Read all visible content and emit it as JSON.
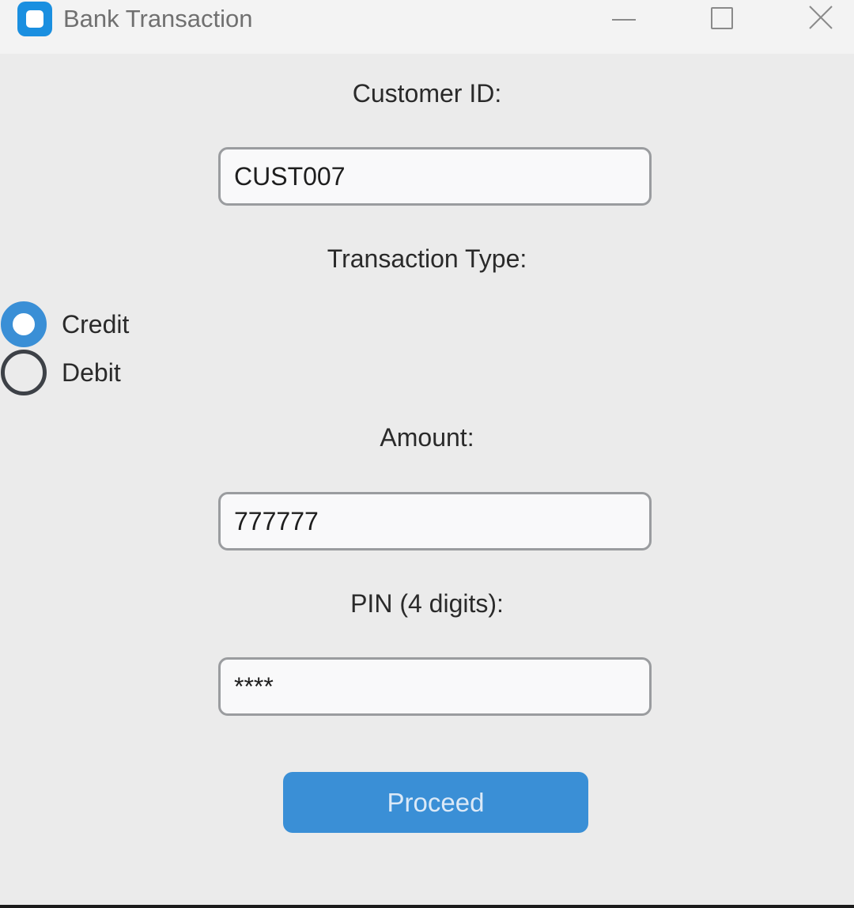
{
  "window": {
    "title": "Bank Transaction",
    "app_icon": "app-icon",
    "controls": [
      "minimize-icon",
      "maximize-icon",
      "close-icon"
    ]
  },
  "form": {
    "customer_id_label": "Customer ID:",
    "customer_id_value": "CUST007",
    "transaction_type_label": "Transaction Type:",
    "transaction_types": [
      {
        "label": "Credit",
        "selected": true
      },
      {
        "label": "Debit",
        "selected": false
      }
    ],
    "amount_label": "Amount:",
    "amount_value": "777777",
    "pin_label": "PIN (4 digits):",
    "pin_value": "****",
    "proceed_label": "Proceed"
  },
  "colors": {
    "accent": "#3a8fd6",
    "app_icon": "#1a8fe0",
    "background": "#ebebeb"
  }
}
